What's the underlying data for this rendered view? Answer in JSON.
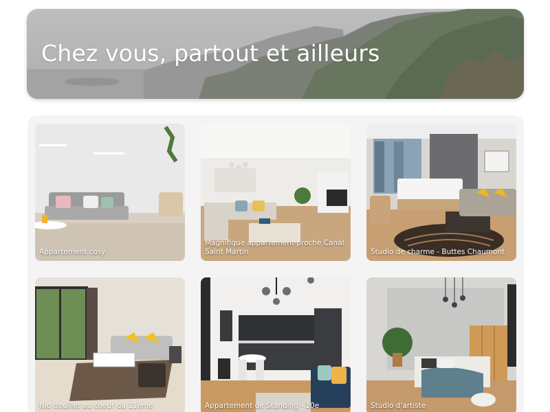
{
  "hero": {
    "title": "Chez vous, partout et ailleurs"
  },
  "listings": [
    {
      "label": "Appartement cosy"
    },
    {
      "label": "Magnifique appartement proche Canal Saint Martin"
    },
    {
      "label": "Studio de charme - Buttes Chaumont"
    },
    {
      "label": "Nid douillet au coeur du 11ème"
    },
    {
      "label": "Appartement de Standing - 10e"
    },
    {
      "label": "Studio d'artiste"
    }
  ]
}
